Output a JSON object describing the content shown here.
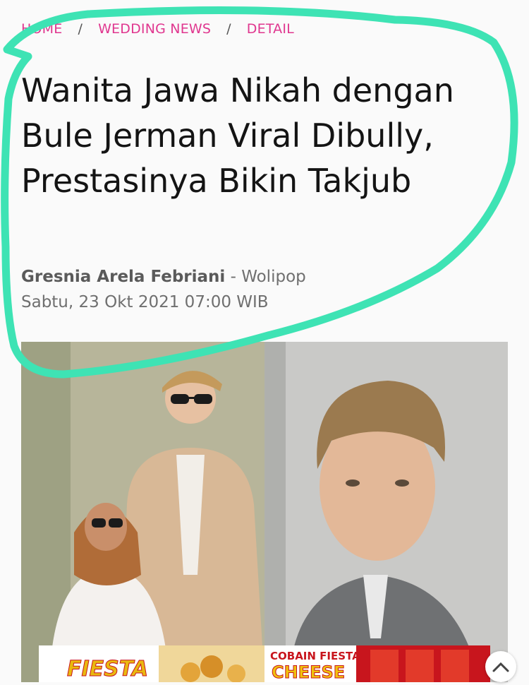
{
  "breadcrumb": {
    "home": "HOME",
    "section": "WEDDING NEWS",
    "current": "DETAIL",
    "separator": "/"
  },
  "article": {
    "title": "Wanita Jawa Nikah dengan Bule Jerman Viral Dibully, Prestasinya Bikin Takjub",
    "author": "Gresnia Arela Febriani",
    "source": "- Wolipop",
    "date": "Sabtu, 23 Okt 2021 07:00 WIB"
  },
  "ad": {
    "brand": "FIESTA",
    "tagline": "COBAIN FIESTA",
    "product": "CHEESE"
  },
  "colors": {
    "accent": "#e0378f",
    "highlight": "#3ee3b4"
  },
  "icons": {
    "ad_expand": "chevron-up-icon"
  }
}
